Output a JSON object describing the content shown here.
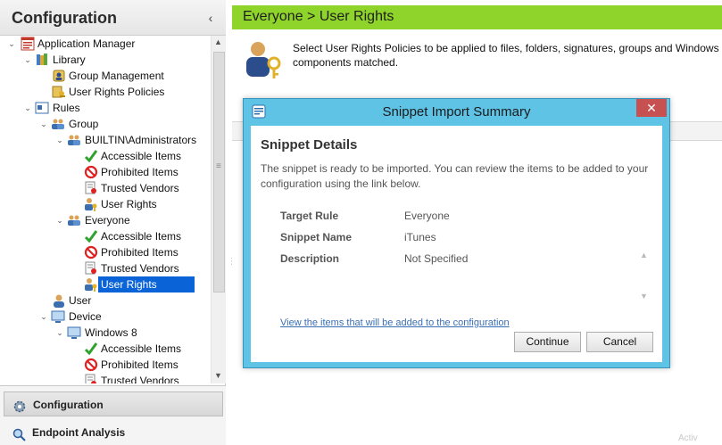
{
  "left_panel": {
    "title": "Configuration",
    "collapse_glyph": "‹",
    "tree": [
      {
        "label": "Application Manager",
        "icon": "app-manager-icon",
        "expanded": true
      },
      {
        "label": "Library",
        "icon": "library-icon",
        "expanded": true
      },
      {
        "label": "Group Management",
        "icon": "group-management-icon"
      },
      {
        "label": "User Rights Policies",
        "icon": "user-rights-policies-icon"
      },
      {
        "label": "Rules",
        "icon": "rules-icon",
        "expanded": true
      },
      {
        "label": "Group",
        "icon": "group-icon",
        "expanded": true
      },
      {
        "label": "BUILTIN\\Administrators",
        "icon": "group-icon",
        "expanded": true
      },
      {
        "label": "Accessible Items",
        "icon": "checkmark-icon"
      },
      {
        "label": "Prohibited Items",
        "icon": "prohibited-icon"
      },
      {
        "label": "Trusted Vendors",
        "icon": "certificate-icon"
      },
      {
        "label": "User Rights",
        "icon": "user-key-icon"
      },
      {
        "label": "Everyone",
        "icon": "group-icon",
        "expanded": true
      },
      {
        "label": "Accessible Items",
        "icon": "checkmark-icon"
      },
      {
        "label": "Prohibited Items",
        "icon": "prohibited-icon"
      },
      {
        "label": "Trusted Vendors",
        "icon": "certificate-icon"
      },
      {
        "label": "User Rights",
        "icon": "user-key-icon",
        "selected": true
      },
      {
        "label": "User",
        "icon": "user-icon"
      },
      {
        "label": "Device",
        "icon": "device-icon",
        "expanded": true
      },
      {
        "label": "Windows 8",
        "icon": "device-icon",
        "expanded": true
      },
      {
        "label": "Accessible Items",
        "icon": "checkmark-icon"
      },
      {
        "label": "Prohibited Items",
        "icon": "prohibited-icon"
      },
      {
        "label": "Trusted Vendors",
        "icon": "certificate-icon"
      }
    ],
    "sections": [
      {
        "label": "Configuration",
        "icon": "gear-icon",
        "active": true
      },
      {
        "label": "Endpoint Analysis",
        "icon": "endpoint-analysis-icon"
      }
    ]
  },
  "main": {
    "banner_title": "Everyone > User Rights",
    "description": "Select User Rights Policies to be applied to files, folders, signatures, groups and Windows components matched.",
    "faint_text": "Activ"
  },
  "dialog": {
    "title": "Snippet Import Summary",
    "close_glyph": "✕",
    "heading": "Snippet Details",
    "intro": "The snippet is ready to be imported. You can review the items to be added to your configuration using the link below.",
    "fields": [
      {
        "key": "Target Rule",
        "value": "Everyone"
      },
      {
        "key": "Snippet Name",
        "value": "iTunes"
      },
      {
        "key": "Description",
        "value": "Not Specified"
      }
    ],
    "link": "View the items that will be added to the configuration",
    "continue_label": "Continue",
    "cancel_label": "Cancel"
  },
  "colors": {
    "banner": "#8ed42a",
    "dialog_frame": "#5fc3e6",
    "selection": "#0a64d8",
    "close_button": "#c75050",
    "link": "#3a6fb5"
  }
}
